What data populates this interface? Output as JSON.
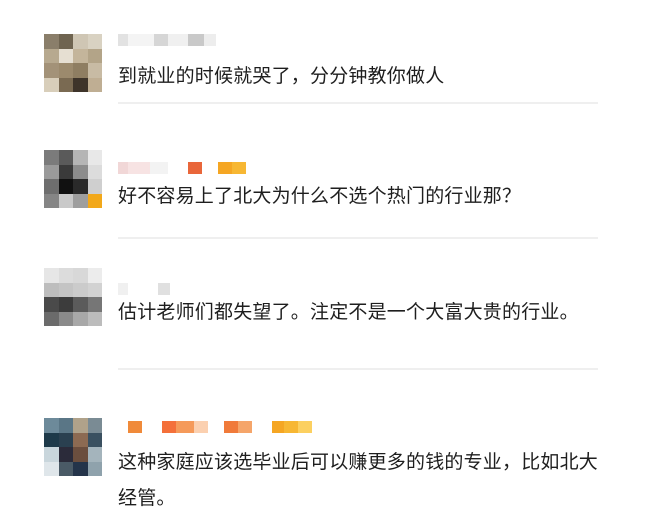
{
  "comments": [
    {
      "text": "到就业的时候就哭了，分分钟教你做人"
    },
    {
      "text": "好不容易上了北大为什么不选个热门的行业那？"
    },
    {
      "text": "估计老师们都失望了。注定不是一个大富大贵的行业。"
    },
    {
      "text": "这种家庭应该选毕业后可以赚更多的钱的专业，比如北大经管。"
    }
  ],
  "colors": {
    "text": "#1e1e1e",
    "divider": "#efefef",
    "background": "#ffffff"
  }
}
